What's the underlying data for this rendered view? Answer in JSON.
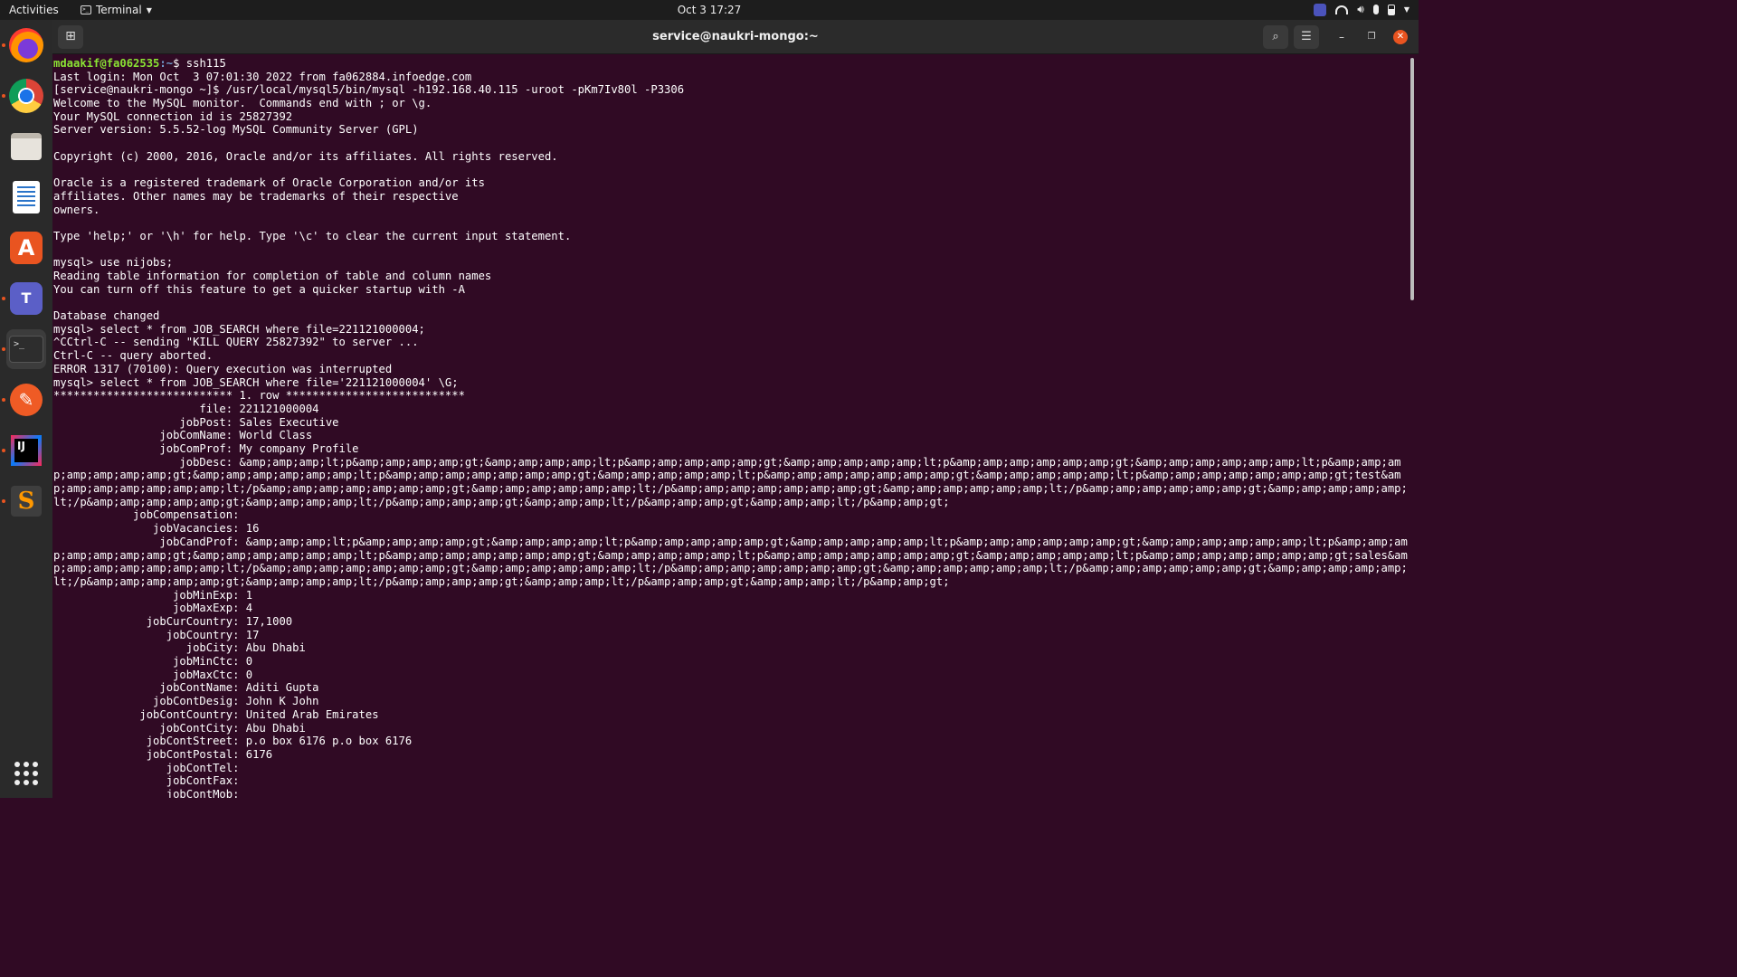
{
  "topbar": {
    "activities": "Activities",
    "app_name": "Terminal",
    "clock": "Oct 3  17:27"
  },
  "dock": {
    "apps": [
      "firefox",
      "chrome",
      "files",
      "libreoffice-writer",
      "ubuntu-software",
      "teams",
      "terminal",
      "postman",
      "intellij-idea",
      "sublime-text"
    ]
  },
  "window": {
    "title": "service@naukri-mongo:~"
  },
  "terminal": {
    "prompt_user": "mdaakif@fa062535",
    "prompt_path": ":~",
    "first_command": "$ ssh115",
    "lines": [
      "Last login: Mon Oct  3 07:01:30 2022 from fa062884.infoedge.com",
      "[service@naukri-mongo ~]$ /usr/local/mysql5/bin/mysql -h192.168.40.115 -uroot -pKm7Iv80l -P3306",
      "Welcome to the MySQL monitor.  Commands end with ; or \\g.",
      "Your MySQL connection id is 25827392",
      "Server version: 5.5.52-log MySQL Community Server (GPL)",
      "",
      "Copyright (c) 2000, 2016, Oracle and/or its affiliates. All rights reserved.",
      "",
      "Oracle is a registered trademark of Oracle Corporation and/or its",
      "affiliates. Other names may be trademarks of their respective",
      "owners.",
      "",
      "Type 'help;' or '\\h' for help. Type '\\c' to clear the current input statement.",
      "",
      "mysql> use nijobs;",
      "Reading table information for completion of table and column names",
      "You can turn off this feature to get a quicker startup with -A",
      "",
      "Database changed",
      "mysql> select * from JOB_SEARCH where file=221121000004;",
      "^CCtrl-C -- sending \"KILL QUERY 25827392\" to server ...",
      "Ctrl-C -- query aborted.",
      "ERROR 1317 (70100): Query execution was interrupted",
      "mysql> select * from JOB_SEARCH where file='221121000004' \\G;",
      "*************************** 1. row ***************************",
      "                      file: 221121000004",
      "                   jobPost: Sales Executive",
      "                jobComName: World Class",
      "                jobComProf: My company Profile",
      "                   jobDesc: &amp;amp;amp;lt;p&amp;amp;amp;amp;gt;&amp;amp;amp;amp;lt;p&amp;amp;amp;amp;amp;gt;&amp;amp;amp;amp;amp;lt;p&amp;amp;amp;amp;amp;amp;gt;&amp;amp;amp;amp;amp;amp;lt;p&amp;amp;amp;amp;amp;amp;amp;gt;&amp;amp;amp;amp;amp;amp;lt;p&amp;amp;amp;amp;amp;amp;amp;gt;&amp;amp;amp;amp;amp;lt;p&amp;amp;amp;amp;amp;amp;amp;gt;&amp;amp;amp;amp;amp;lt;p&amp;amp;amp;amp;amp;amp;amp;gt;test&amp;amp;amp;amp;amp;amp;amp;lt;/p&amp;amp;amp;amp;amp;amp;amp;gt;&amp;amp;amp;amp;amp;amp;lt;/p&amp;amp;amp;amp;amp;amp;amp;gt;&amp;amp;amp;amp;amp;amp;lt;/p&amp;amp;amp;amp;amp;amp;gt;&amp;amp;amp;amp;amp;lt;/p&amp;amp;amp;amp;amp;gt;&amp;amp;amp;amp;lt;/p&amp;amp;amp;amp;gt;&amp;amp;amp;lt;/p&amp;amp;amp;gt;&amp;amp;amp;lt;/p&amp;amp;gt;",
      "            jobCompensation: ",
      "               jobVacancies: 16",
      "                jobCandProf: &amp;amp;amp;lt;p&amp;amp;amp;amp;gt;&amp;amp;amp;amp;lt;p&amp;amp;amp;amp;amp;gt;&amp;amp;amp;amp;amp;lt;p&amp;amp;amp;amp;amp;amp;gt;&amp;amp;amp;amp;amp;amp;lt;p&amp;amp;amp;amp;amp;amp;amp;gt;&amp;amp;amp;amp;amp;amp;lt;p&amp;amp;amp;amp;amp;amp;amp;gt;&amp;amp;amp;amp;amp;lt;p&amp;amp;amp;amp;amp;amp;amp;gt;&amp;amp;amp;amp;amp;lt;p&amp;amp;amp;amp;amp;amp;amp;gt;sales&amp;amp;amp;amp;amp;amp;amp;lt;/p&amp;amp;amp;amp;amp;amp;amp;gt;&amp;amp;amp;amp;amp;amp;lt;/p&amp;amp;amp;amp;amp;amp;amp;gt;&amp;amp;amp;amp;amp;amp;lt;/p&amp;amp;amp;amp;amp;amp;gt;&amp;amp;amp;amp;amp;lt;/p&amp;amp;amp;amp;amp;gt;&amp;amp;amp;amp;lt;/p&amp;amp;amp;amp;gt;&amp;amp;amp;lt;/p&amp;amp;amp;gt;&amp;amp;amp;lt;/p&amp;amp;gt;",
      "                  jobMinExp: 1",
      "                  jobMaxExp: 4",
      "              jobCurCountry: 17,1000",
      "                 jobCountry: 17",
      "                    jobCity: Abu Dhabi",
      "                  jobMinCtc: 0",
      "                  jobMaxCtc: 0",
      "                jobContName: Aditi Gupta",
      "               jobContDesig: John K John",
      "             jobContCountry: United Arab Emirates",
      "                jobContCity: Abu Dhabi",
      "              jobContStreet: p.o box 6176 p.o box 6176",
      "              jobContPostal: 6176",
      "                 jobContTel: ",
      "                 jobContFax: ",
      "                 jobContMob: "
    ]
  }
}
